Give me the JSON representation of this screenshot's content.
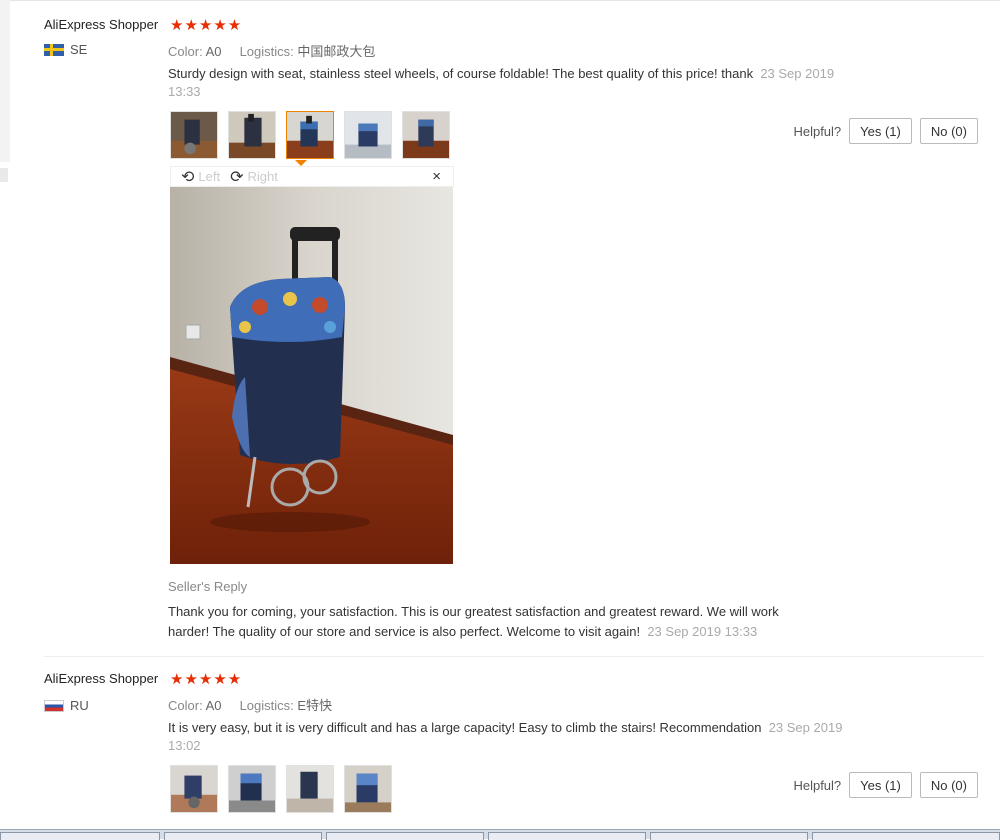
{
  "reviews": [
    {
      "name": "AliExpress Shopper",
      "stars": "★★★★★",
      "country": "SE",
      "color_label": "Color:",
      "color_value": "A0",
      "logistics_label": "Logistics:",
      "logistics_value": "中国邮政大包",
      "text": "Sturdy design with seat, stainless steel wheels, of course foldable! The best quality of this price! thank",
      "date": "23 Sep 2019 13:33",
      "helpful_label": "Helpful?",
      "yes_label": "Yes (1)",
      "no_label": "No (0)"
    },
    {
      "name": "AliExpress Shopper",
      "stars": "★★★★★",
      "country": "RU",
      "color_label": "Color:",
      "color_value": "A0",
      "logistics_label": "Logistics:",
      "logistics_value": "E特快",
      "text": "It is very easy, but it is very difficult and has a large capacity! Easy to climb the stairs! Recommendation",
      "date": "23 Sep 2019 13:02",
      "helpful_label": "Helpful?",
      "yes_label": "Yes (1)",
      "no_label": "No (0)"
    }
  ],
  "viewer": {
    "left_label": "Left",
    "right_label": "Right",
    "close_glyph": "×",
    "rotate_left_glyph": "⟲",
    "rotate_right_glyph": "⟳"
  },
  "seller_reply": {
    "title": "Seller's Reply",
    "text": "Thank you for coming, your satisfaction. This is our greatest satisfaction and greatest reward. We will work harder! The quality of our store and service is also perfect. Welcome to visit again!",
    "date": "23 Sep 2019 13:33"
  },
  "colors": {
    "star": "#e62e04",
    "accent_border": "#f08200"
  }
}
